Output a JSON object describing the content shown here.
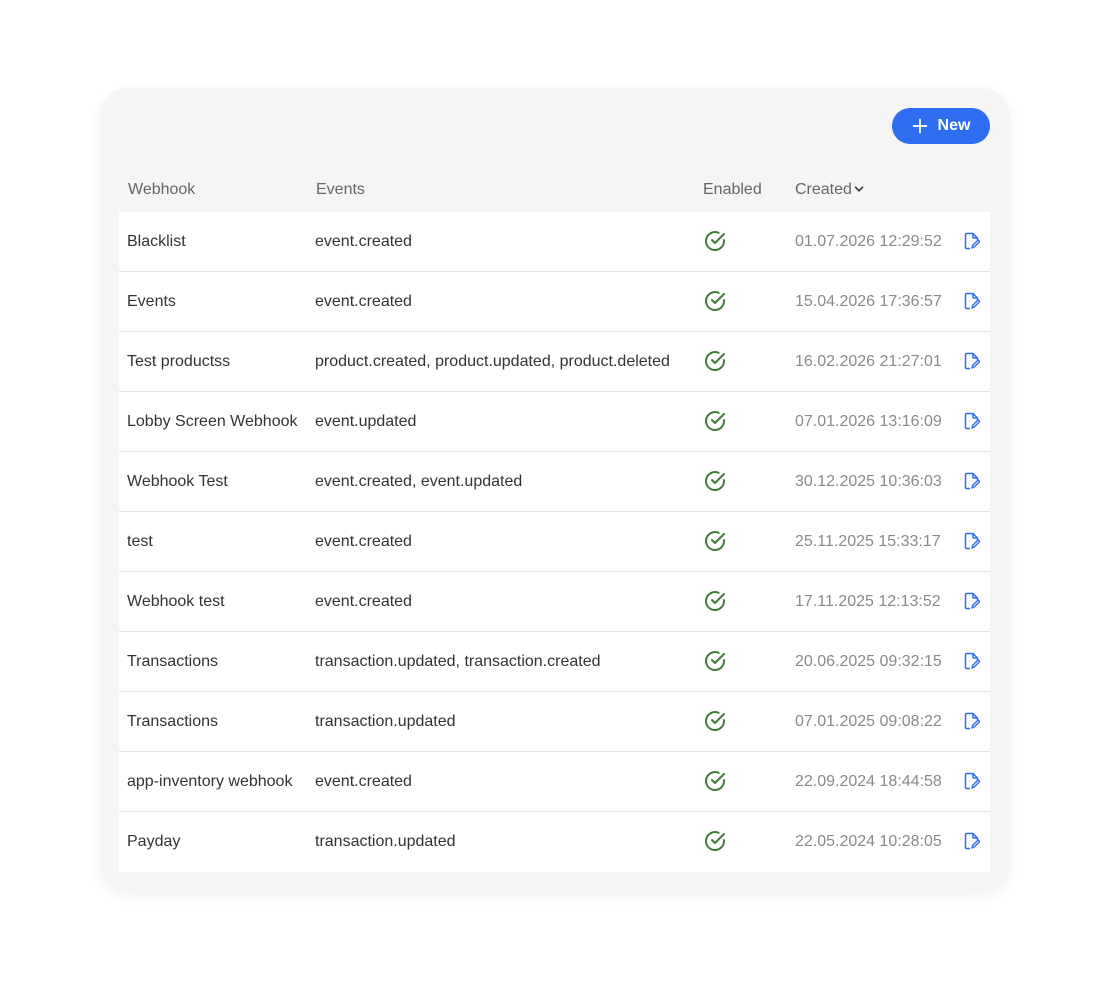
{
  "toolbar": {
    "new_label": "New"
  },
  "table": {
    "headers": {
      "webhook": "Webhook",
      "events": "Events",
      "enabled": "Enabled",
      "created": "Created"
    },
    "sort": {
      "column": "created",
      "direction": "descending",
      "icon": "chevron-down-icon"
    },
    "rows": [
      {
        "name": "Blacklist",
        "events": "event.created",
        "enabled": true,
        "created": "01.07.2026 12:29:52"
      },
      {
        "name": "Events",
        "events": "event.created",
        "enabled": true,
        "created": "15.04.2026 17:36:57"
      },
      {
        "name": "Test productss",
        "events": "product.created, product.updated, product.deleted",
        "enabled": true,
        "created": "16.02.2026 21:27:01"
      },
      {
        "name": "Lobby Screen Webhook",
        "events": "event.updated",
        "enabled": true,
        "created": "07.01.2026 13:16:09"
      },
      {
        "name": "Webhook Test",
        "events": "event.created, event.updated",
        "enabled": true,
        "created": "30.12.2025 10:36:03"
      },
      {
        "name": "test",
        "events": "event.created",
        "enabled": true,
        "created": "25.11.2025 15:33:17"
      },
      {
        "name": "Webhook test",
        "events": "event.created",
        "enabled": true,
        "created": "17.11.2025 12:13:52"
      },
      {
        "name": "Transactions",
        "events": "transaction.updated, transaction.created",
        "enabled": true,
        "created": "20.06.2025 09:32:15"
      },
      {
        "name": "Transactions",
        "events": "transaction.updated",
        "enabled": true,
        "created": "07.01.2025 09:08:22"
      },
      {
        "name": "app-inventory webhook",
        "events": "event.created",
        "enabled": true,
        "created": "22.09.2024 18:44:58"
      },
      {
        "name": "Payday",
        "events": "transaction.updated",
        "enabled": true,
        "created": "22.05.2024 10:28:05"
      }
    ]
  },
  "colors": {
    "primary": "#2f6df0",
    "enabled_check": "#3f7a3a",
    "edit_icon": "#2f6df0",
    "card_background": "#f5f5f5"
  },
  "icons": {
    "new": "plus-icon",
    "enabled": "check-circle-icon",
    "edit": "edit-document-icon"
  }
}
